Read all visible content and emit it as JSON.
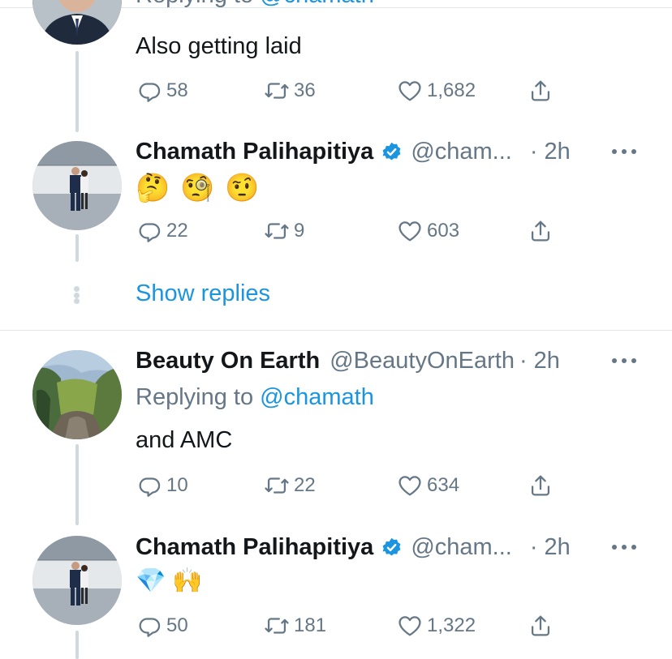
{
  "tweets": [
    {
      "reply_to_prefix": "Replying to",
      "reply_to_handle": "@chamath",
      "text": "Also getting laid",
      "replies": "58",
      "retweets": "36",
      "likes": "1,682"
    },
    {
      "name": "Chamath Palihapitiya",
      "handle": "@cham...",
      "time": "· 2h",
      "emojis": [
        "🤔",
        "🧐",
        "🤨"
      ],
      "replies": "22",
      "retweets": "9",
      "likes": "603"
    },
    {
      "name": "Beauty On Earth",
      "handle": "@BeautyOnEarth",
      "time": "· 2h",
      "reply_to_prefix": "Replying to",
      "reply_to_handle": "@chamath",
      "text": "and AMC",
      "replies": "10",
      "retweets": "22",
      "likes": "634"
    },
    {
      "name": "Chamath Palihapitiya",
      "handle": "@cham...",
      "time": "· 2h",
      "emojis": [
        "💎",
        "🙌"
      ],
      "replies": "50",
      "retweets": "181",
      "likes": "1,322"
    }
  ],
  "show_replies_label": "Show replies",
  "colors": {
    "link_blue": "#1b95e0",
    "secondary_text": "#657786",
    "primary_text": "#14171a",
    "thread_line": "#cfd9de",
    "divider": "#e1e8ed"
  },
  "icons": [
    "reply-icon",
    "retweet-icon",
    "like-icon",
    "share-icon",
    "verified-badge-icon",
    "more-icon"
  ]
}
